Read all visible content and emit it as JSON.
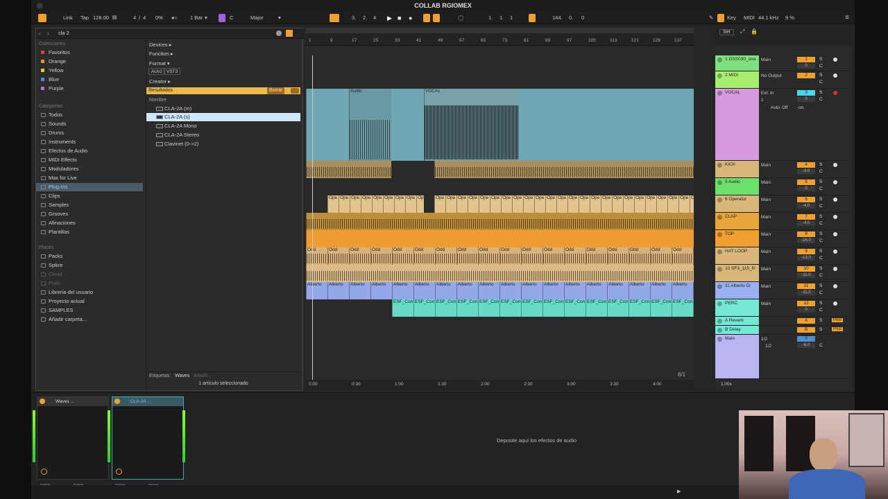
{
  "window": {
    "title": "COLLAB RGIOMEX"
  },
  "control_bar": {
    "link": "Link",
    "tap": "Tap",
    "tempo": "128.00",
    "time_sig_num": "4",
    "time_sig_den": "4",
    "overdrive": "0%",
    "quantize": "1 Bar",
    "key": "C",
    "scale": "Major",
    "position": [
      "3.",
      "2.",
      "4"
    ],
    "loop_start": [
      "1.",
      "1.",
      "1"
    ],
    "loop_length": [
      "144.",
      "0.",
      "0"
    ],
    "key_btn": "Key",
    "midi_btn": "MIDI",
    "sample_rate": "44.1 kHz",
    "cpu": "9 %"
  },
  "browser": {
    "search_value": "cla 2",
    "collections_header": "Colecciones",
    "collections": [
      {
        "label": "Favoritos",
        "color": "#e04040"
      },
      {
        "label": "Orange",
        "color": "#f09030"
      },
      {
        "label": "Yellow",
        "color": "#e8d030"
      },
      {
        "label": "Blue",
        "color": "#4090e0"
      },
      {
        "label": "Purple",
        "color": "#b070e0"
      }
    ],
    "categories_header": "Categorías",
    "categories": [
      "Todos",
      "Sounds",
      "Drums",
      "Instruments",
      "Efectos de Audio",
      "MIDI Effects",
      "Moduladores",
      "Max for Live",
      "Plug-Ins",
      "Clips",
      "Samples",
      "Grooves",
      "Afinaciones",
      "Plantillas"
    ],
    "places_header": "Places",
    "places": [
      "Packs",
      "Splice",
      "Cloud",
      "Push",
      "Librería del usuario",
      "Proyecto actual",
      "SAMPLES",
      "Añadir carpeta..."
    ],
    "filters": {
      "devices": "Devices ▸",
      "function": "Function ▸",
      "format": "Format ▾",
      "format_tags": [
        "AUv2",
        "VST3"
      ],
      "creator": "Creator ▸"
    },
    "results_label": "Resultados",
    "clear_label": "Borrar",
    "name_header": "Nombre",
    "results": [
      "CLA-2A (m)",
      "CLA-2A (s)",
      "CLA-2A Mono",
      "CLA-2A Stereo",
      "Clavinet (0->2)"
    ],
    "tags_label": "Etiquetas:",
    "tag_waves": "Waves",
    "tag_add": "Añadir...",
    "status": "1 artículo seleccionado"
  },
  "arrangement": {
    "ruler": [
      "1",
      "9",
      "17",
      "25",
      "33",
      "41",
      "49",
      "57",
      "65",
      "73",
      "81",
      "89",
      "97",
      "105",
      "113",
      "121",
      "129",
      "137",
      "145"
    ],
    "timeline": [
      "0:00",
      "0:30",
      "1:00",
      "1:30",
      "2:00",
      "2:30",
      "3:00",
      "3:30",
      "4:00",
      "4:30"
    ],
    "clips": {
      "audio": "Audio",
      "vocal": "VOCAL",
      "ope": "Ope",
      "odd": "Odd",
      "alberto": "Alberto",
      "esf": "ESF_Con"
    },
    "zoom": "8/1"
  },
  "mixer": {
    "set_label": "Set",
    "tracks": [
      {
        "name": "1 GSS030_sna",
        "color": "#7ee07e",
        "out": "Main",
        "num": "1",
        "vol": "0"
      },
      {
        "name": "2 MIDI",
        "color": "#a7ee6e",
        "out": "No Output",
        "num": "2",
        "vol": ""
      },
      {
        "name": "VOCAL",
        "color": "#d59ae0",
        "out": "Ext. In",
        "num": "3",
        "vol": "0"
      },
      {
        "name": "KICK",
        "color": "#d9b67a",
        "out": "Main",
        "num": "4",
        "vol": "-3.0"
      },
      {
        "name": "5 Audio",
        "color": "#6be06b",
        "out": "Main",
        "num": "5",
        "vol": "0"
      },
      {
        "name": "6 Operator",
        "color": "#d9b67a",
        "out": "Main",
        "num": "6",
        "vol": "-4.0"
      },
      {
        "name": "CLAP",
        "color": "#e8a53a",
        "out": "Main",
        "num": "7",
        "vol": "-4.0"
      },
      {
        "name": "TOP",
        "color": "#f0a030",
        "out": "Main",
        "num": "8",
        "vol": "-16.0"
      },
      {
        "name": "HAT LOOP",
        "color": "#d9b67a",
        "out": "Main",
        "num": "9",
        "vol": "-13.0"
      },
      {
        "name": "10 SF3_115_R",
        "color": "#d9b67a",
        "out": "Main",
        "num": "10",
        "vol": "-11.0"
      },
      {
        "name": "11 Alberto Di",
        "color": "#9ab0f0",
        "out": "Main",
        "num": "11",
        "vol": "-11.0"
      },
      {
        "name": "PERC",
        "color": "#74e8d4",
        "out": "Main",
        "num": "12",
        "vol": "0"
      },
      {
        "name": "A Reverb",
        "color": "#74e8d4",
        "out": "",
        "num": "A",
        "vol": ""
      },
      {
        "name": "B Delay",
        "color": "#74e8d4",
        "out": "",
        "num": "B",
        "vol": ""
      },
      {
        "name": "Main",
        "color": "#b9b4f2",
        "out": "1/2",
        "num": "0",
        "vol": "-6.0"
      }
    ],
    "ext_in_ch": "1",
    "auto": "Auto",
    "off": "Off",
    "in_val": "-oo",
    "sends_post": "Post",
    "cue": "1/2",
    "tempo_scale": "1.00x",
    "hw": [
      "H",
      "W"
    ],
    "s": "S",
    "c": "C"
  },
  "devices": {
    "waves": "Waves ...",
    "cla": "CLA-2A ...",
    "none": "none",
    "drop_hint": "Deposite aquí los efectos de audio"
  }
}
